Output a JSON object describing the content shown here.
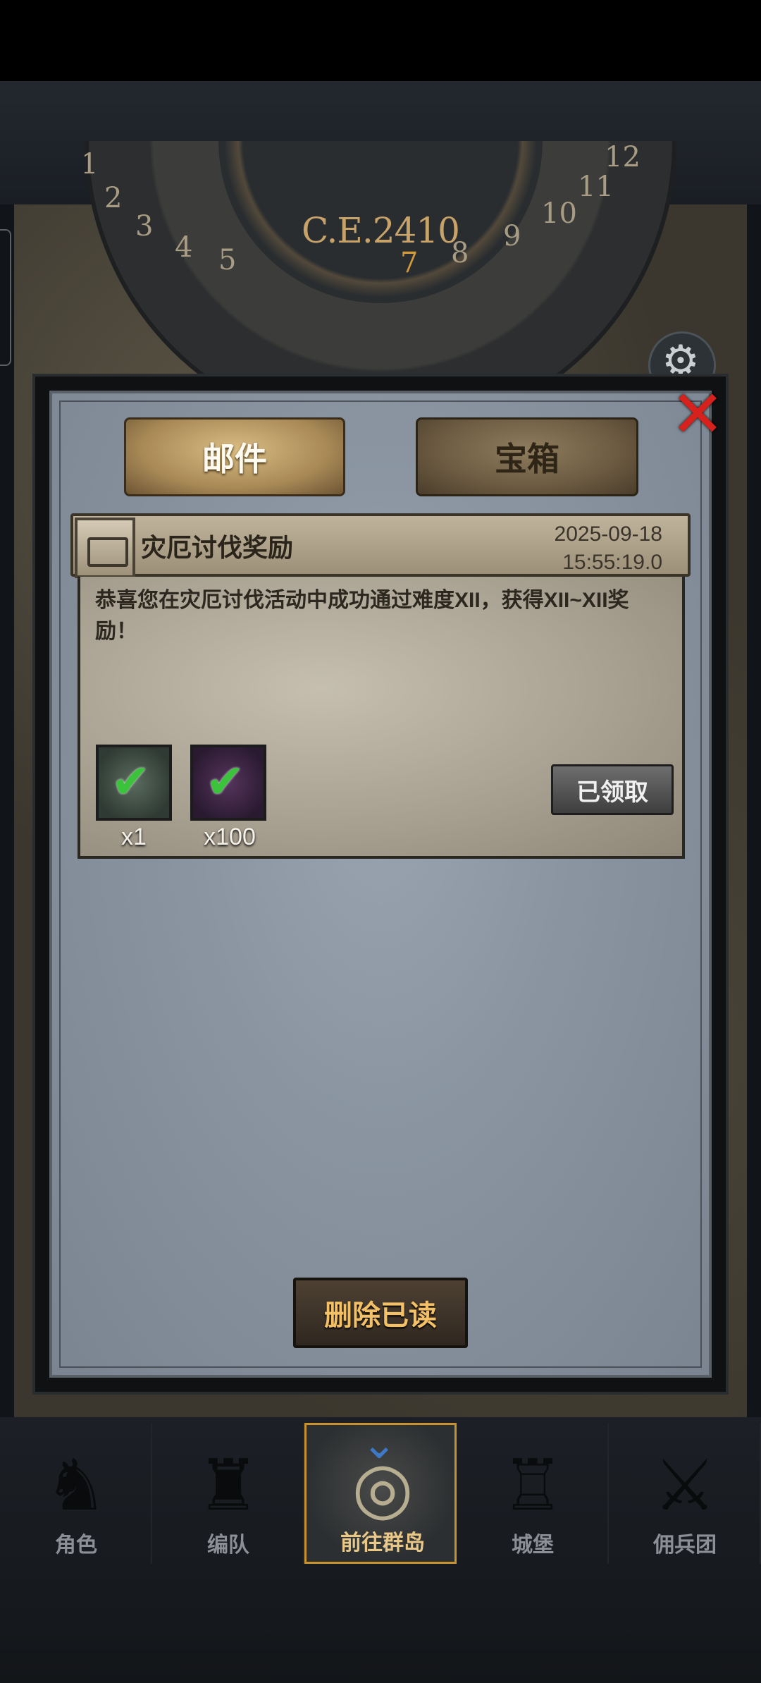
{
  "hud": {
    "era_label": "C.E.2410",
    "dial_numbers": [
      "1",
      "2",
      "3",
      "4",
      "5",
      "7",
      "8",
      "9",
      "10",
      "11",
      "12"
    ]
  },
  "dialog": {
    "close_symbol": "✕",
    "tabs": [
      {
        "label": "邮件",
        "active": true
      },
      {
        "label": "宝箱",
        "active": false
      }
    ],
    "mail": {
      "title": "灾厄讨伐奖励",
      "date": "2025-09-18",
      "time": "15:55:19.0",
      "body": "恭喜您在灾厄讨伐活动中成功通过难度XII，获得XII~XII奖励！",
      "rewards": [
        {
          "icon": "banner-reward-icon",
          "quantity": "x1",
          "claimed": true
        },
        {
          "icon": "purple-crystal-icon",
          "quantity": "x100",
          "claimed": true
        }
      ],
      "claimed_label": "已领取"
    },
    "delete_read_label": "删除已读"
  },
  "bottom_nav": {
    "items": [
      {
        "label": "角色",
        "icon": "knight-helmet-icon",
        "active": false
      },
      {
        "label": "编队",
        "icon": "formation-icon",
        "active": false
      },
      {
        "label": "前往群岛",
        "icon": "globe-compass-icon",
        "active": true
      },
      {
        "label": "城堡",
        "icon": "castle-icon",
        "active": false
      },
      {
        "label": "佣兵团",
        "icon": "mercenary-icon",
        "active": false
      }
    ]
  },
  "colors": {
    "accent_gold": "#c8932e",
    "close_red": "#d6211c",
    "check_green": "#3bc43b"
  }
}
